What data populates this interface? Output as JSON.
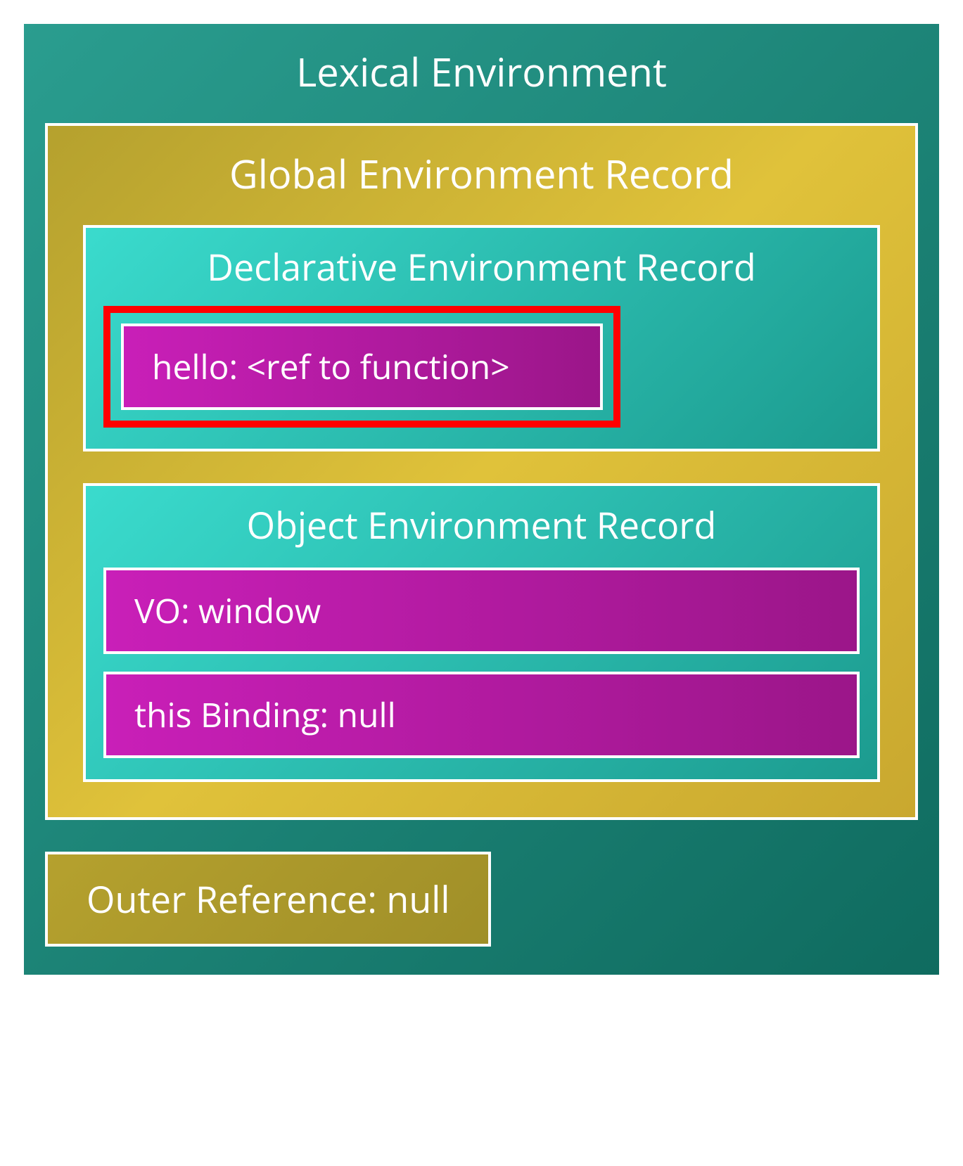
{
  "lexicalEnv": {
    "title": "Lexical Environment",
    "globalRecord": {
      "title": "Global Environment Record",
      "declarativeRecord": {
        "title": "Declarative Environment Record",
        "entries": [
          {
            "text": "hello: <ref to function>",
            "highlighted": true
          }
        ]
      },
      "objectRecord": {
        "title": "Object Environment Record",
        "entries": [
          {
            "text": "VO: window"
          },
          {
            "text": "this Binding: null"
          }
        ]
      }
    },
    "outerReference": {
      "text": "Outer Reference: null"
    }
  }
}
